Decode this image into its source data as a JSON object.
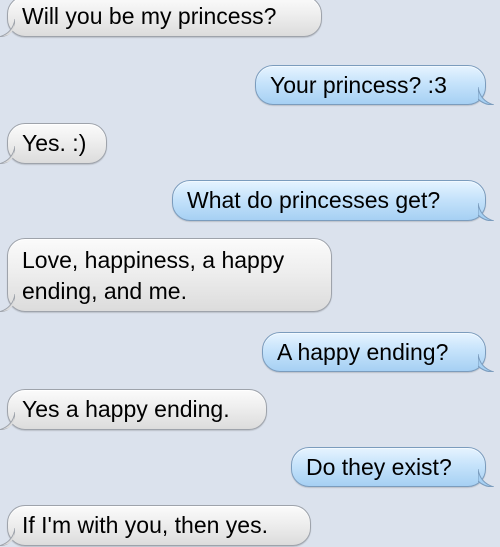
{
  "messages": [
    {
      "sender": "them",
      "text": "Will you be my princess?"
    },
    {
      "sender": "me",
      "text": "Your princess? :3"
    },
    {
      "sender": "them",
      "text": "Yes. :)"
    },
    {
      "sender": "me",
      "text": "What do princesses get?"
    },
    {
      "sender": "them",
      "text": "Love, happiness, a happy ending, and me."
    },
    {
      "sender": "me",
      "text": "A happy ending?"
    },
    {
      "sender": "them",
      "text": "Yes a happy ending."
    },
    {
      "sender": "me",
      "text": "Do they exist?"
    },
    {
      "sender": "them",
      "text": "If I'm with you, then yes."
    }
  ],
  "colors": {
    "background": "#dbe2ed",
    "incoming_bubble": "#eeeeee",
    "outgoing_bubble": "#c6e3fb"
  }
}
